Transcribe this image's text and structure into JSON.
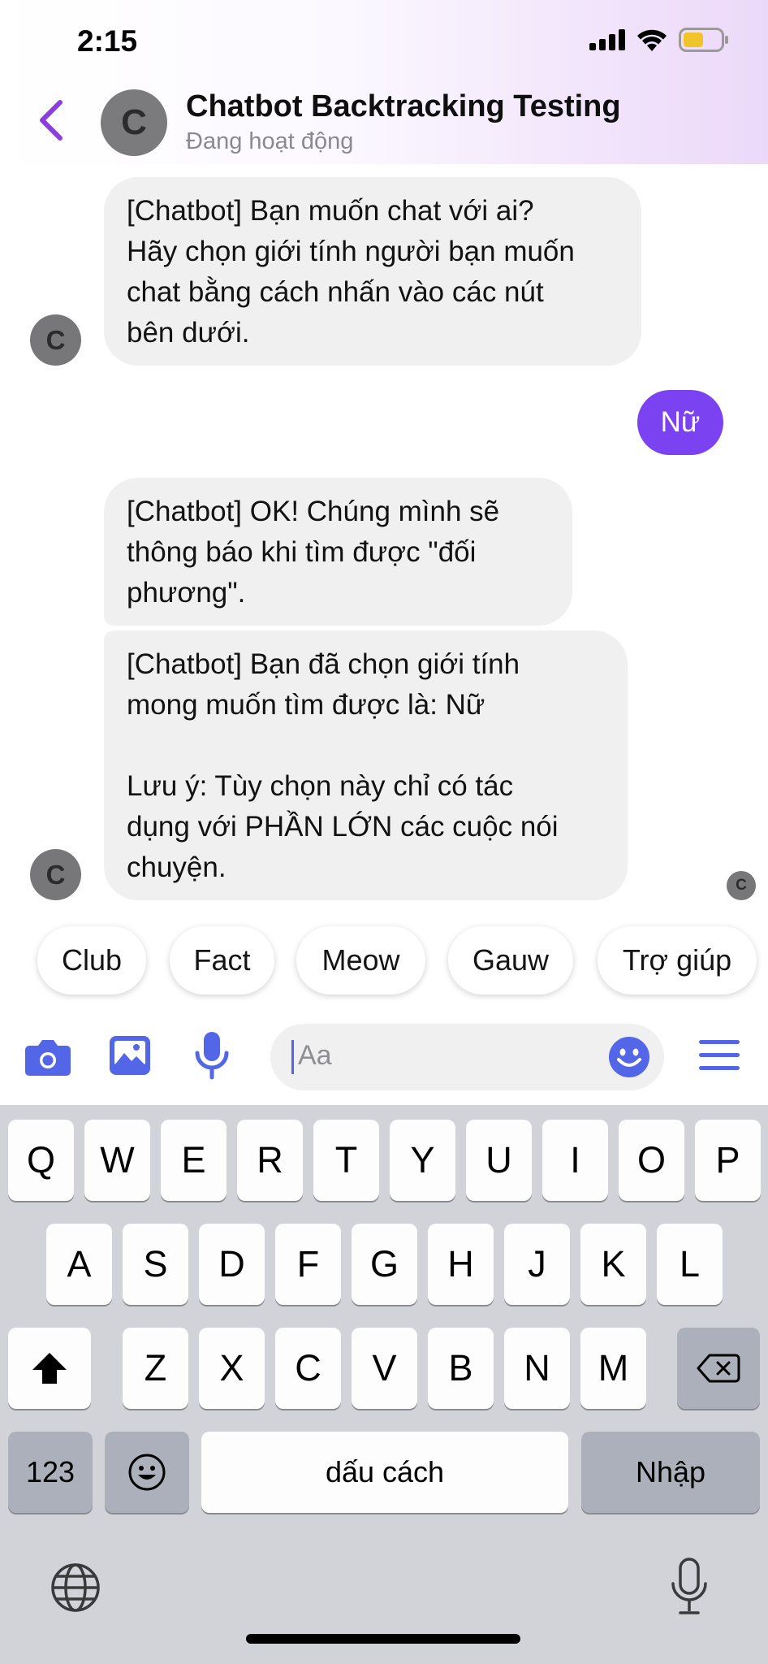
{
  "status_bar": {
    "time": "2:15"
  },
  "header": {
    "avatar_letter": "C",
    "title": "Chatbot Backtracking Testing",
    "subtitle": "Đang hoạt động"
  },
  "messages": [
    {
      "from": "bot",
      "lines": [
        "[Chatbot] Bạn muốn chat với ai?",
        "Hãy chọn giới tính người bạn muốn",
        "chat bằng cách nhấn vào các nút",
        "bên dưới."
      ],
      "avatar_letter": "C"
    },
    {
      "from": "me",
      "text": "Nữ"
    },
    {
      "from": "bot",
      "lines": [
        "[Chatbot] OK! Chúng mình sẽ",
        "thông báo khi tìm được \"đối",
        "phương\"."
      ]
    },
    {
      "from": "bot",
      "lines": [
        "[Chatbot] Bạn đã chọn giới tính",
        "mong muốn tìm được là: Nữ",
        "",
        "Lưu ý: Tùy chọn này chỉ có tác",
        "dụng với PHẦN LỚN các cuộc nói",
        "chuyện."
      ],
      "avatar_letter": "C"
    }
  ],
  "seen_avatar_letter": "C",
  "quick_replies": [
    "Club",
    "Fact",
    "Meow",
    "Gauw",
    "Trợ giúp"
  ],
  "composer": {
    "placeholder": "Aa",
    "icons": [
      "camera-icon",
      "image-icon",
      "microphone-icon",
      "emoji-icon",
      "menu-icon"
    ],
    "accent_color": "#5466e8"
  },
  "keyboard": {
    "row1": [
      "Q",
      "W",
      "E",
      "R",
      "T",
      "Y",
      "U",
      "I",
      "O",
      "P"
    ],
    "row2": [
      "A",
      "S",
      "D",
      "F",
      "G",
      "H",
      "J",
      "K",
      "L"
    ],
    "row3": [
      "Z",
      "X",
      "C",
      "V",
      "B",
      "N",
      "M"
    ],
    "numbers_label": "123",
    "space_label": "dấu cách",
    "return_label": "Nhập"
  },
  "colors": {
    "sent_bubble": "#7a42f0",
    "received_bubble": "#f0f0f0",
    "back_arrow": "#8b3ee0"
  }
}
